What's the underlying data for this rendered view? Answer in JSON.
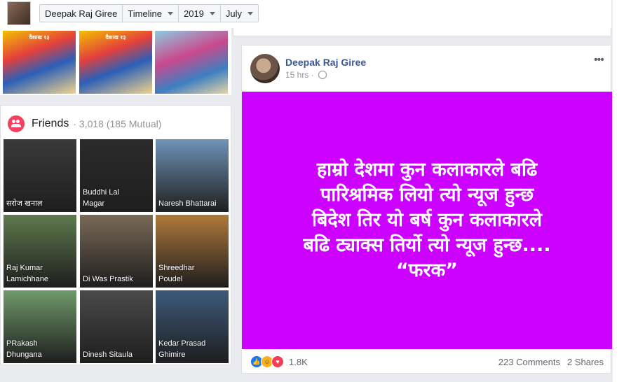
{
  "header": {
    "profile_name": "Deepak Raj Giree",
    "crumbs": [
      {
        "label": "Timeline",
        "dropdown": true
      },
      {
        "label": "2019",
        "dropdown": true
      },
      {
        "label": "July",
        "dropdown": true
      }
    ]
  },
  "posters": [
    {
      "top_text": "वैशाख १३"
    },
    {
      "top_text": "वैशाख १३"
    },
    {
      "top_text": ""
    }
  ],
  "friends": {
    "title": "Friends",
    "count": "· 3,018 (185 Mutual)",
    "items": [
      {
        "name": "सरोज खनाल",
        "color": "#3a3a3a"
      },
      {
        "name": "Buddhi Lal\nMagar",
        "color": "#2b2b2b"
      },
      {
        "name": "Naresh Bhattarai",
        "color": "#6f93b8"
      },
      {
        "name": "Raj Kumar\nLamichhane",
        "color": "#5e7a4e"
      },
      {
        "name": "Di Was Prastik",
        "color": "#7a6a57"
      },
      {
        "name": "Shreedhar\nPoudel",
        "color": "#b07a3a"
      },
      {
        "name": "PRakash\nDhungana",
        "color": "#6e9a6a"
      },
      {
        "name": "Dinesh Sitaula",
        "color": "#4a4a4a"
      },
      {
        "name": "Kedar Prasad\nGhimire",
        "color": "#3d5a7a"
      }
    ]
  },
  "post": {
    "author": "Deepak Raj Giree",
    "time": "15 hrs ·",
    "menu": "•••",
    "text": "हाम्रो देशमा कुन कलाकारले बढि\nपारिश्रमिक लियो त्यो न्यूज हुन्छ\nबिदेश तिर यो बर्ष कुन कलाकारले\nबढि ट्याक्स तिर्यो त्यो न्यूज हुन्छ....\n“फरक”",
    "background": "#cc00ff",
    "reactions_count": "1.8K",
    "comments": "223 Comments",
    "shares": "2 Shares"
  }
}
